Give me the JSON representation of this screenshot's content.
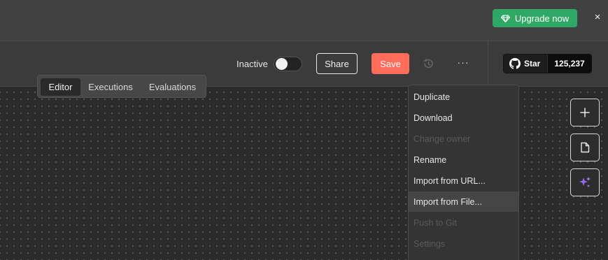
{
  "topbar": {
    "upgrade_label": "Upgrade now",
    "close_label": "×"
  },
  "header": {
    "status_label": "Inactive",
    "share_label": "Share",
    "save_label": "Save",
    "more_label": "···",
    "github": {
      "star_label": "Star",
      "star_count": "125,237"
    }
  },
  "tabs": [
    {
      "label": "Editor",
      "active": true
    },
    {
      "label": "Executions",
      "active": false
    },
    {
      "label": "Evaluations",
      "active": false
    }
  ],
  "menu": {
    "items": [
      {
        "label": "Duplicate",
        "disabled": false
      },
      {
        "label": "Download",
        "disabled": false
      },
      {
        "label": "Change owner",
        "disabled": true
      },
      {
        "label": "Rename",
        "disabled": false
      },
      {
        "label": "Import from URL...",
        "disabled": false
      },
      {
        "label": "Import from File...",
        "disabled": false,
        "hover": true
      },
      {
        "label": "Push to Git",
        "disabled": true
      },
      {
        "label": "Settings",
        "disabled": true
      }
    ]
  },
  "side_buttons": [
    {
      "icon": "plus-icon"
    },
    {
      "icon": "sticky-note-icon"
    },
    {
      "icon": "ai-sparkle-icon"
    }
  ],
  "colors": {
    "upgrade": "#2fa765",
    "save": "#ff6d5a",
    "sparkle": "#9b6bf5"
  }
}
